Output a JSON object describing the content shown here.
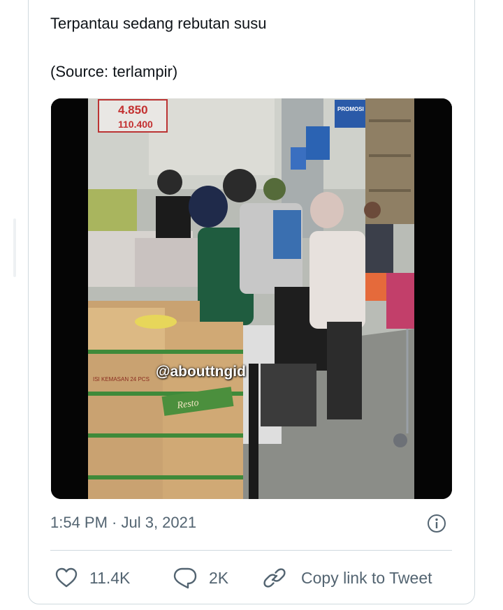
{
  "tweet": {
    "text_line1": "Terpantau sedang rebutan susu",
    "text_line2": "(Source: terlampir)",
    "media": {
      "watermark": "@abouttngid",
      "price_tag_line1": "4.850",
      "price_tag_line2": "110.400",
      "promo_sign": "PROMOSI",
      "box_brand": "Resto",
      "box_label": "ISI KEMASAN 24 PCS"
    },
    "timestamp": "1:54 PM · Jul 3, 2021"
  },
  "actions": {
    "like_count": "11.4K",
    "reply_count": "2K",
    "copy_link_label": "Copy link to Tweet"
  },
  "icons": {
    "like": "heart-icon",
    "reply": "reply-bubble-icon",
    "copy": "link-icon",
    "info": "info-icon"
  },
  "colors": {
    "text": "#0f1419",
    "secondary": "#536471",
    "border": "#cfd9de"
  }
}
